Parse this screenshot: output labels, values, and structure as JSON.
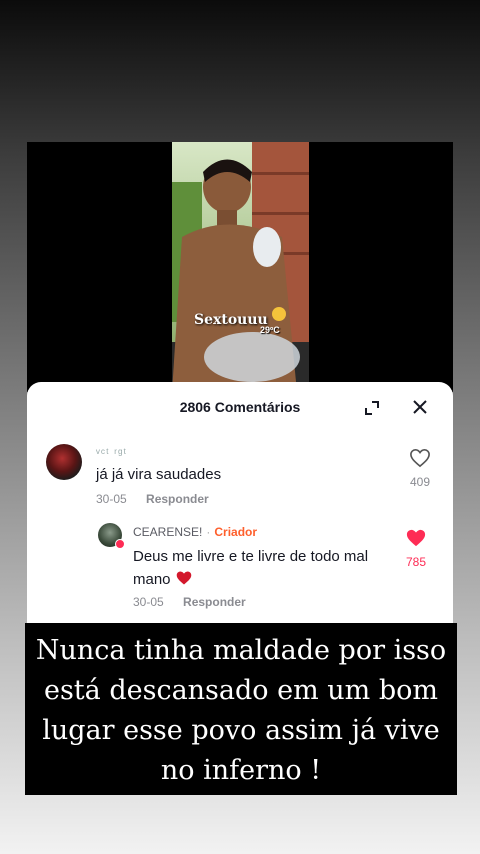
{
  "video": {
    "caption": "Sextouuu",
    "temperature": "29ºC"
  },
  "comments_sheet": {
    "title": "2806 Comentários",
    "comments": [
      {
        "username": "ᵛᶜᵗ ʳᵍᵗ",
        "text": "já já vira saudades",
        "date": "30-05",
        "reply_label": "Responder",
        "likes": "409",
        "liked": false
      },
      {
        "username": "CEARENSE!",
        "badge": "Criador",
        "text": "Deus me livre e te livre de todo mal mano",
        "date": "30-05",
        "reply_label": "Responder",
        "likes": "785",
        "liked": true
      }
    ]
  },
  "caption_overlay": {
    "text": "Nunca tinha maldade por isso está descansado em um bom lugar esse povo assim já vive no inferno !"
  },
  "colors": {
    "like_red": "#fe2c55",
    "creator_orange": "#fe5f2c"
  }
}
